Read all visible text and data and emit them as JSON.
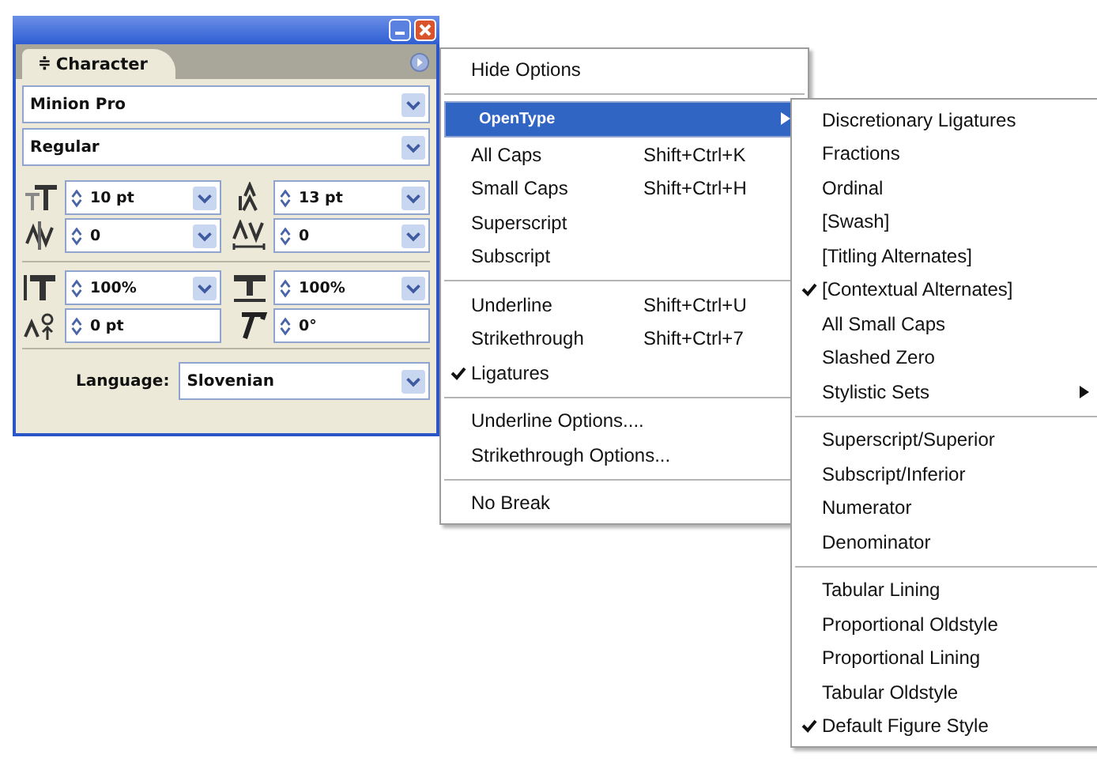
{
  "panel": {
    "tab": {
      "icon": "≑",
      "label": "Character",
      "selected": true
    },
    "font": {
      "value": "Minion Pro"
    },
    "style": {
      "value": "Regular"
    },
    "fields": [
      {
        "value": "10 pt",
        "kind": "combo"
      },
      {
        "value": "13 pt",
        "kind": "combo"
      },
      {
        "value": "0",
        "kind": "combo"
      },
      {
        "value": "0",
        "kind": "combo"
      },
      {
        "value": "100%",
        "kind": "combo"
      },
      {
        "value": "100%",
        "kind": "combo"
      },
      {
        "value": "0 pt",
        "kind": "spin"
      },
      {
        "value": "0°",
        "kind": "spin"
      }
    ],
    "language": {
      "label": "Language:",
      "value": "Slovenian"
    }
  },
  "menu": {
    "groups": [
      [
        {
          "label": "Hide Options",
          "checked": false,
          "selected": false
        }
      ],
      [
        {
          "label": "OpenType",
          "checked": false,
          "selected": true,
          "submenu": true
        },
        {
          "label": "All Caps",
          "shortcut": "Shift+Ctrl+K",
          "checked": false,
          "selected": false
        },
        {
          "label": "Small Caps",
          "shortcut": "Shift+Ctrl+H",
          "checked": false,
          "selected": false
        },
        {
          "label": "Superscript",
          "checked": false,
          "selected": false
        },
        {
          "label": "Subscript",
          "checked": false,
          "selected": false
        }
      ],
      [
        {
          "label": "Underline",
          "shortcut": "Shift+Ctrl+U",
          "checked": false,
          "selected": false
        },
        {
          "label": "Strikethrough",
          "shortcut": "Shift+Ctrl+7",
          "checked": false,
          "selected": false
        },
        {
          "label": "Ligatures",
          "checked": true,
          "selected": false
        }
      ],
      [
        {
          "label": "Underline Options....",
          "checked": false,
          "selected": false
        },
        {
          "label": "Strikethrough Options...",
          "checked": false,
          "selected": false
        }
      ],
      [
        {
          "label": "No Break",
          "checked": false,
          "selected": false
        }
      ]
    ]
  },
  "submenu": {
    "groups": [
      [
        {
          "label": "Discretionary Ligatures",
          "checked": false,
          "selected": false
        },
        {
          "label": "Fractions",
          "checked": false,
          "selected": false
        },
        {
          "label": "Ordinal",
          "checked": false,
          "selected": false
        },
        {
          "label": "[Swash]",
          "checked": false,
          "selected": false
        },
        {
          "label": "[Titling Alternates]",
          "checked": false,
          "selected": false
        },
        {
          "label": "[Contextual Alternates]",
          "checked": true,
          "selected": false
        },
        {
          "label": "All Small Caps",
          "checked": false,
          "selected": false
        },
        {
          "label": "Slashed Zero",
          "checked": false,
          "selected": false
        },
        {
          "label": "Stylistic Sets",
          "checked": false,
          "selected": false,
          "submenu": true
        }
      ],
      [
        {
          "label": "Superscript/Superior",
          "checked": false,
          "selected": false
        },
        {
          "label": "Subscript/Inferior",
          "checked": false,
          "selected": false
        },
        {
          "label": "Numerator",
          "checked": false,
          "selected": false
        },
        {
          "label": "Denominator",
          "checked": false,
          "selected": false
        }
      ],
      [
        {
          "label": "Tabular Lining",
          "checked": false,
          "selected": false
        },
        {
          "label": "Proportional Oldstyle",
          "checked": false,
          "selected": false
        },
        {
          "label": "Proportional Lining",
          "checked": false,
          "selected": false
        },
        {
          "label": "Tabular Oldstyle",
          "checked": false,
          "selected": false
        },
        {
          "label": "Default Figure Style",
          "checked": true,
          "selected": false
        }
      ]
    ]
  }
}
